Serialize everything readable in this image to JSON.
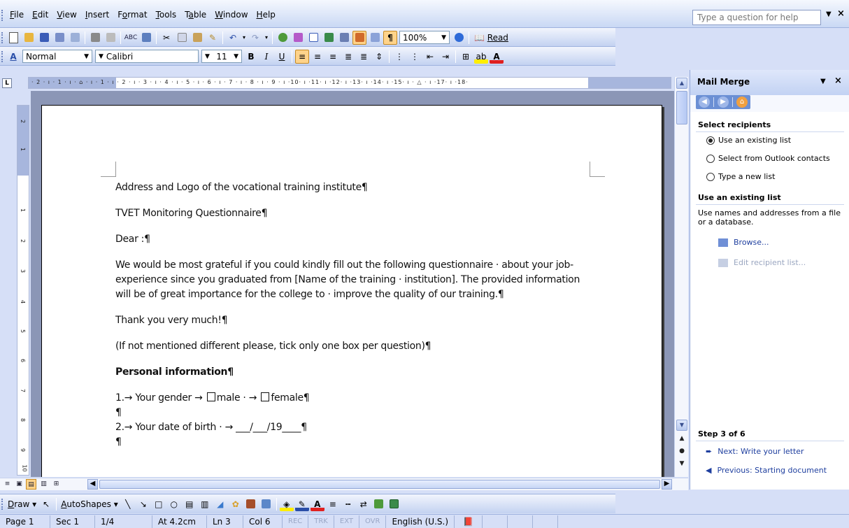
{
  "menu": {
    "items": [
      {
        "label": "File",
        "key": "F",
        "rest": "ile"
      },
      {
        "label": "Edit",
        "key": "E",
        "rest": "dit"
      },
      {
        "label": "View",
        "key": "V",
        "rest": "iew"
      },
      {
        "label": "Insert",
        "key": "I",
        "rest": "nsert"
      },
      {
        "label": "Format",
        "key": "F",
        "pre": "",
        "rest": "ormat",
        "underline_index": 1
      },
      {
        "label": "Tools",
        "key": "T",
        "rest": "ools"
      },
      {
        "label": "Table",
        "key": "T",
        "rest": "able"
      },
      {
        "label": "Window",
        "key": "W",
        "rest": "indow"
      },
      {
        "label": "Help",
        "key": "H",
        "rest": "elp"
      }
    ],
    "help_placeholder": "Type a question for help"
  },
  "standard_toolbar": {
    "zoom": "100%",
    "read_label": "Read"
  },
  "formatting_toolbar": {
    "style": "Normal",
    "font": "Calibri",
    "size": "11",
    "style_icon": "A"
  },
  "ruler": {
    "ticks": "· 2 · ı · 1 · ı · ⌂ · ı · 1 · ı · 2 · ı · 3 · ı · 4 · ı · 5 · ı · 6 · ı · 7 · ı · 8 · ı · 9 · ı ·10· ı ·11· ı ·12· ı ·13· ı ·14· ı ·15· ı · △ · ı ·17· ı ·18·",
    "vertical_ticks": [
      "2",
      "1",
      "1",
      "2",
      "3",
      "4",
      "5",
      "6",
      "7",
      "8",
      "9",
      "10"
    ]
  },
  "document": {
    "paragraphs": [
      "Address and Logo of the vocational training institute¶",
      "TVET Monitoring Questionnaire¶",
      "Dear :¶",
      "We would be most grateful if you could kindly fill out the following questionnaire · about your job-experience since you graduated from [Name of the training · institution]. The provided information will be of great importance for the college to · improve the quality of our training.¶",
      "Thank you very much!¶",
      " (If not mentioned different please, tick only one box per question)¶",
      "Personal information¶"
    ],
    "q1_prefix": "1.→ Your gender  →",
    "q1_male": "male ·  →",
    "q1_female": "female¶",
    "pilcrow": "¶",
    "q2": "2.→ Your date of birth ·  →   ___/___/19____¶",
    "pilcrow2": "¶"
  },
  "view_buttons": [
    "≡",
    "▣",
    "▤",
    "▥",
    "⊞"
  ],
  "draw_toolbar": {
    "draw": "Draw",
    "autoshapes": "AutoShapes"
  },
  "status": {
    "page": "Page 1",
    "sec": "Sec 1",
    "count": "1/4",
    "at": "At 4.2cm",
    "ln": "Ln 3",
    "col": "Col 6",
    "rec": "REC",
    "trk": "TRK",
    "ext": "EXT",
    "ovr": "OVR",
    "lang": "English (U.S.)"
  },
  "task_pane": {
    "title": "Mail Merge",
    "section1": "Select recipients",
    "options": [
      "Use an existing list",
      "Select from Outlook contacts",
      "Type a new list"
    ],
    "selected_index": 0,
    "section2": "Use an existing list",
    "description": "Use names and addresses from a file or a database.",
    "browse": "Browse...",
    "edit_list": "Edit recipient list...",
    "step": "Step 3 of 6",
    "next": "Next: Write your letter",
    "previous": "Previous: Starting document"
  },
  "colors": {
    "accent": "#ffd38a",
    "link": "#1f3f9f",
    "toolbar": "#c3d2f1"
  }
}
